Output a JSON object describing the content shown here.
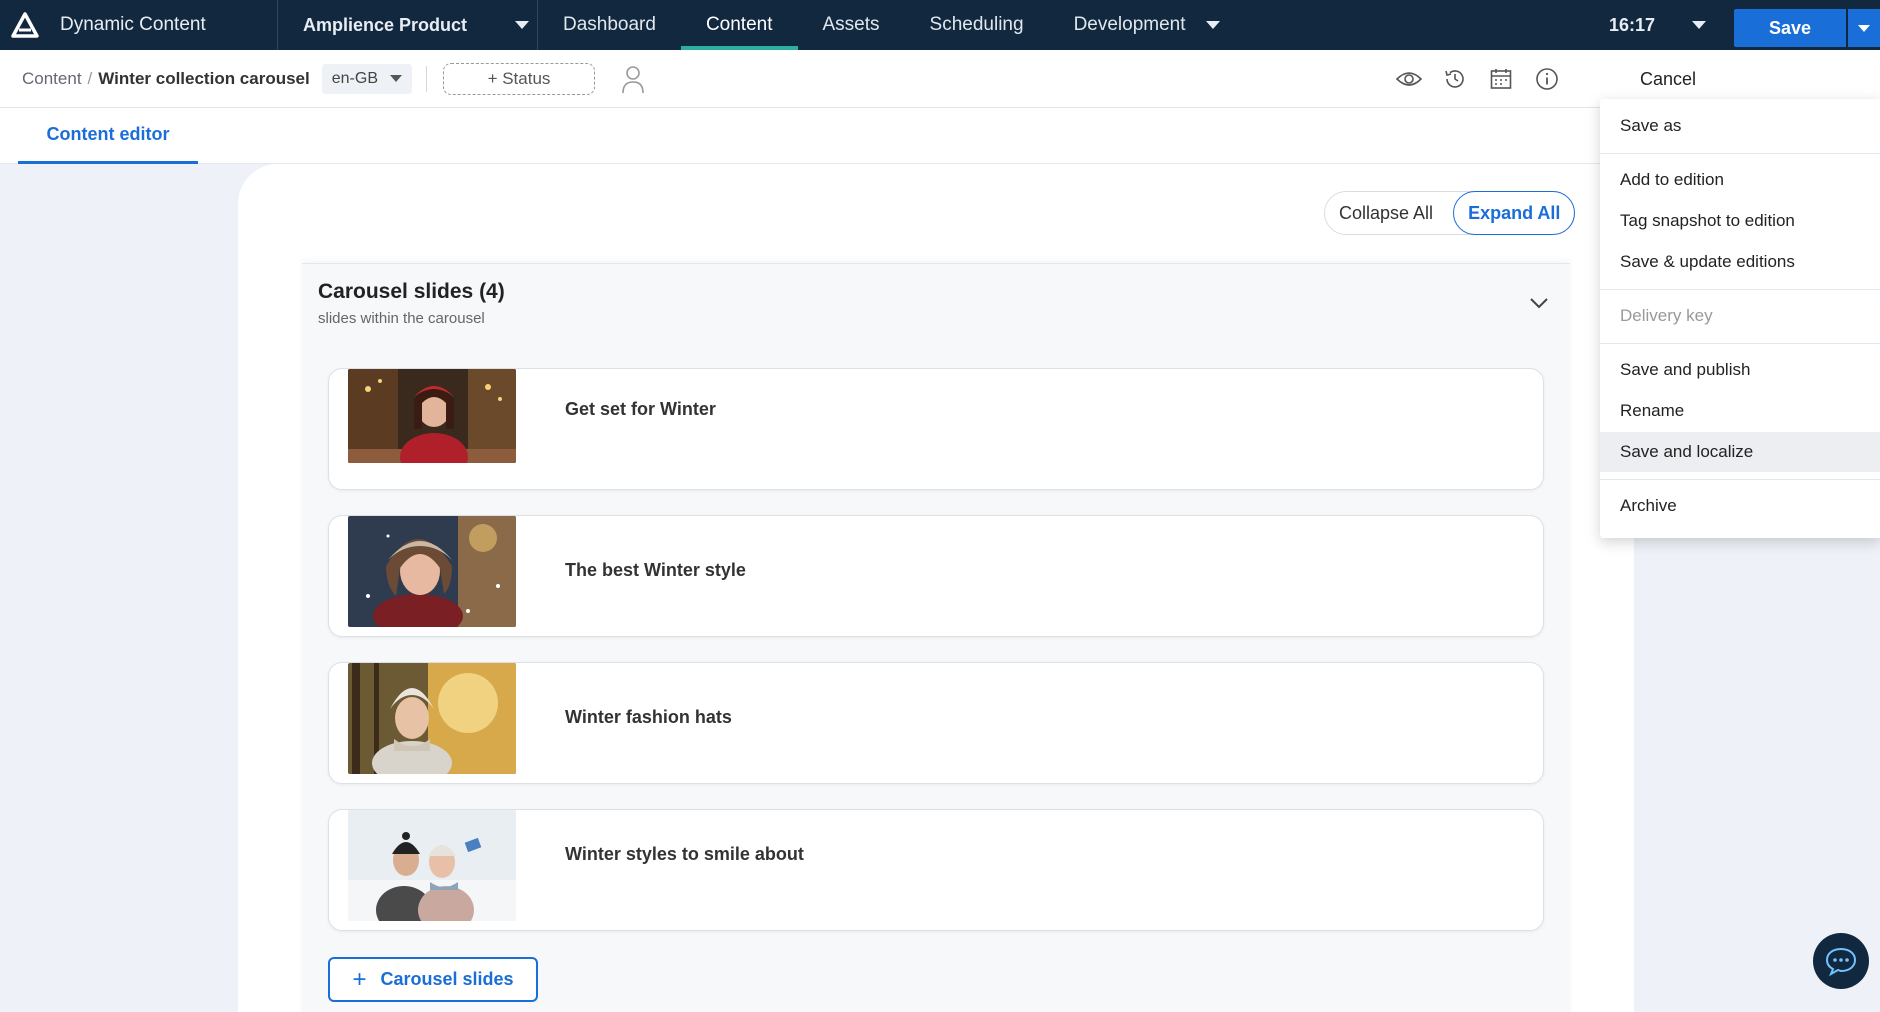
{
  "topbar": {
    "app_name": "Dynamic Content",
    "hub_name": "Amplience Product",
    "tabs": [
      {
        "label": "Dashboard"
      },
      {
        "label": "Content"
      },
      {
        "label": "Assets"
      },
      {
        "label": "Scheduling"
      },
      {
        "label": "Development"
      }
    ],
    "active_tab": "Content",
    "clock": "16:17"
  },
  "breadcrumb": {
    "root": "Content",
    "separator": "/",
    "current": "Winter collection carousel"
  },
  "locale": "en-GB",
  "status_button": "+ Status",
  "actions": {
    "cancel": "Cancel",
    "save": "Save"
  },
  "editor_tab": "Content editor",
  "toggle": {
    "collapse": "Collapse All",
    "expand": "Expand All"
  },
  "group": {
    "title": "Carousel slides (4)",
    "subtitle": "slides within the carousel"
  },
  "slides": [
    {
      "label": "Get set for Winter"
    },
    {
      "label": "The best Winter style"
    },
    {
      "label": "Winter fashion hats"
    },
    {
      "label": "Winter styles to smile about"
    }
  ],
  "add_button": "Carousel slides",
  "dropdown": {
    "items": [
      {
        "label": "Save as"
      },
      {
        "label": "Add to edition"
      },
      {
        "label": "Tag snapshot to edition"
      },
      {
        "label": "Save & update editions"
      },
      {
        "label": "Delivery key",
        "disabled": true
      },
      {
        "label": "Save and publish"
      },
      {
        "label": "Rename"
      },
      {
        "label": "Save and localize",
        "highlighted": true
      },
      {
        "label": "Archive"
      }
    ]
  },
  "colors": {
    "nav_bg": "#11283f",
    "accent": "#1a6ed8",
    "active_tab_indicator": "#2bb0a0"
  }
}
